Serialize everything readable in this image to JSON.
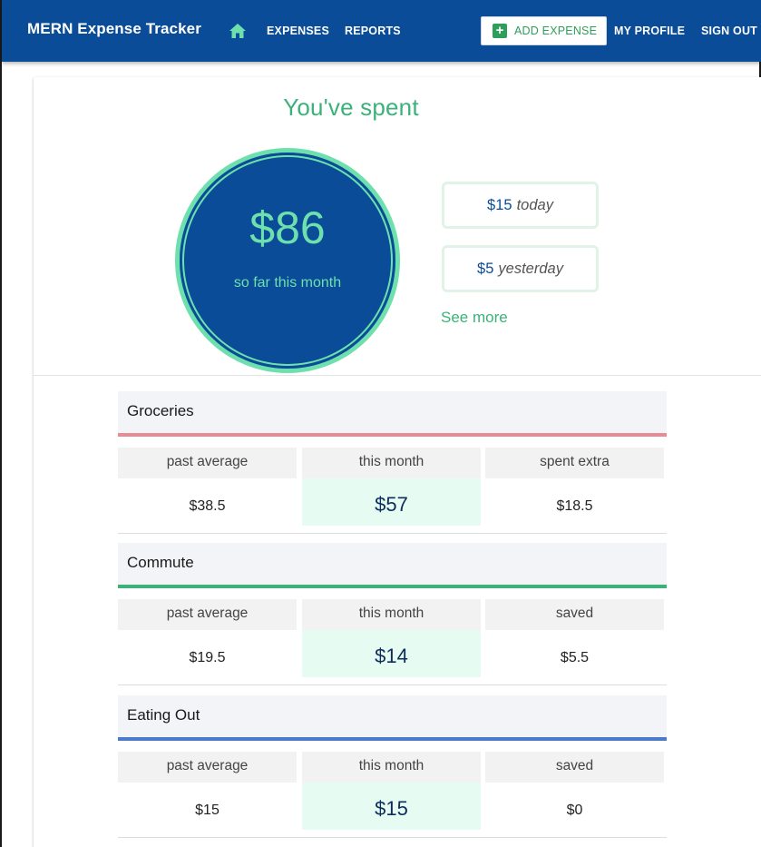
{
  "appbar": {
    "title": "MERN Expense Tracker",
    "home_icon": "home-icon",
    "links": [
      "EXPENSES",
      "REPORTS"
    ],
    "add_expense": "ADD EXPENSE",
    "my_profile": "MY PROFILE",
    "sign_out": "SIGN OUT"
  },
  "summary": {
    "title": "You've spent",
    "month_total": "$86",
    "month_label": "so far this month",
    "today_amount": "$15",
    "today_label": "today",
    "yesterday_amount": "$5",
    "yesterday_label": "yesterday",
    "see_more": "See more"
  },
  "categories": [
    {
      "name": "Groceries",
      "color": "#e88b95",
      "headers": [
        "past average",
        "this month",
        "spent extra"
      ],
      "values": [
        "$38.5",
        "$57",
        "$18.5"
      ]
    },
    {
      "name": "Commute",
      "color": "#3bb27a",
      "headers": [
        "past average",
        "this month",
        "saved"
      ],
      "values": [
        "$19.5",
        "$14",
        "$5.5"
      ]
    },
    {
      "name": "Eating Out",
      "color": "#4a7ac9",
      "headers": [
        "past average",
        "this month",
        "saved"
      ],
      "values": [
        "$15",
        "$15",
        "$0"
      ]
    }
  ],
  "colors": {
    "primary": "#0a4c97",
    "accent": "#3bb27a",
    "circle_text": "#6de0ae"
  }
}
